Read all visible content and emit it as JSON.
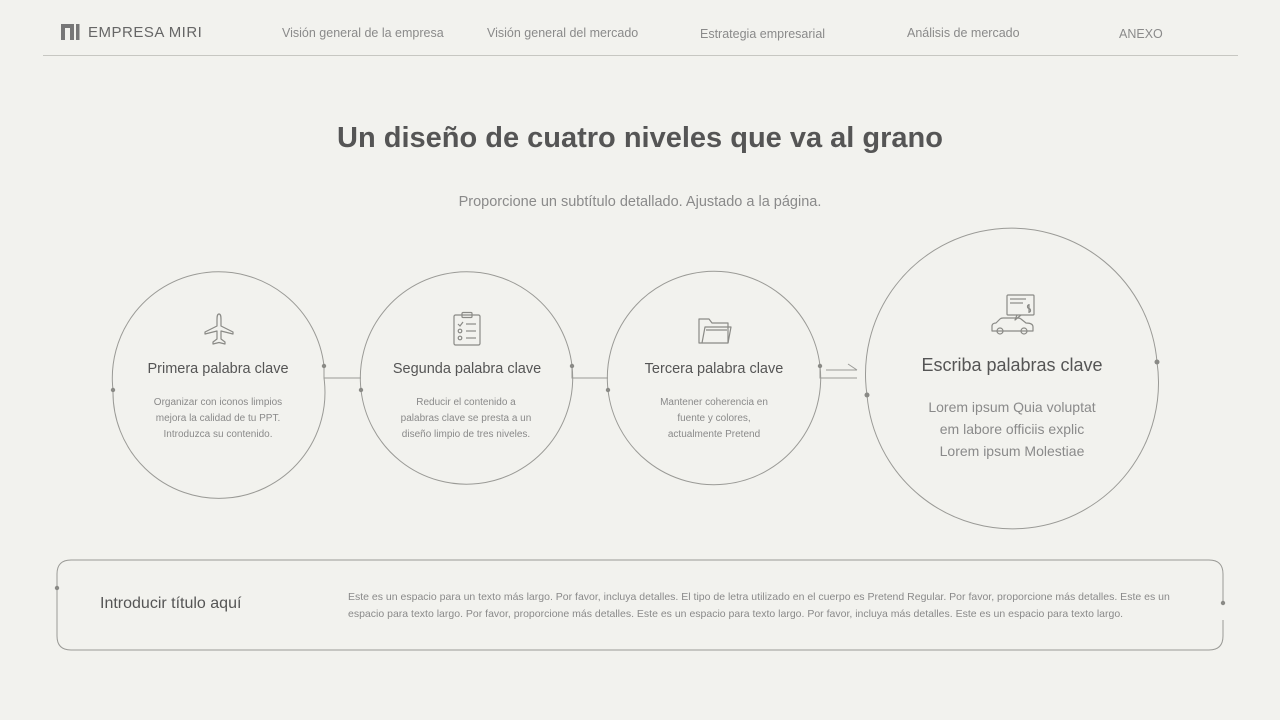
{
  "header": {
    "brand": "EMPRESA MIRI",
    "nav": [
      "Visión general de la empresa",
      "Visión general del mercado",
      "Estrategia empresarial",
      "Análisis de mercado",
      "ANEXO"
    ]
  },
  "slide": {
    "title": "Un diseño de cuatro niveles que va al grano",
    "subtitle": "Proporcione un subtítulo detallado. Ajustado a la página."
  },
  "steps": [
    {
      "icon": "airplane-icon",
      "label": "Primera palabra clave",
      "desc": [
        "Organizar con iconos limpios",
        "mejora la calidad de tu PPT.",
        "Introduzca su contenido."
      ]
    },
    {
      "icon": "clipboard-checklist-icon",
      "label": "Segunda palabra clave",
      "desc": [
        "Reducir el contenido a",
        "palabras clave se presta a un",
        "diseño limpio de tres niveles."
      ]
    },
    {
      "icon": "folder-icon",
      "label": "Tercera palabra clave",
      "desc": [
        "Mantener coherencia en",
        "fuente y colores,",
        "actualmente Pretend"
      ]
    }
  ],
  "final_step": {
    "icon": "car-price-sign-icon",
    "label": "Escriba palabras clave",
    "desc": [
      "Lorem ipsum Quia voluptat",
      "em labore officiis explic",
      "Lorem ipsum Molestiae"
    ]
  },
  "bottom": {
    "title": "Introducir título aquí",
    "text": "Este es un espacio para un texto más largo. Por favor, incluya detalles. El tipo de letra utilizado en el cuerpo es Pretend Regular. Por favor, proporcione más detalles. Este es un espacio para texto largo. Por favor, proporcione más detalles. Este es un espacio para texto largo. Por favor, incluya más detalles. Este es un espacio para texto largo."
  },
  "colors": {
    "background": "#f2f2ee",
    "line": "#9a9a96",
    "text_dark": "#555555",
    "text_light": "#8a8a8a"
  }
}
